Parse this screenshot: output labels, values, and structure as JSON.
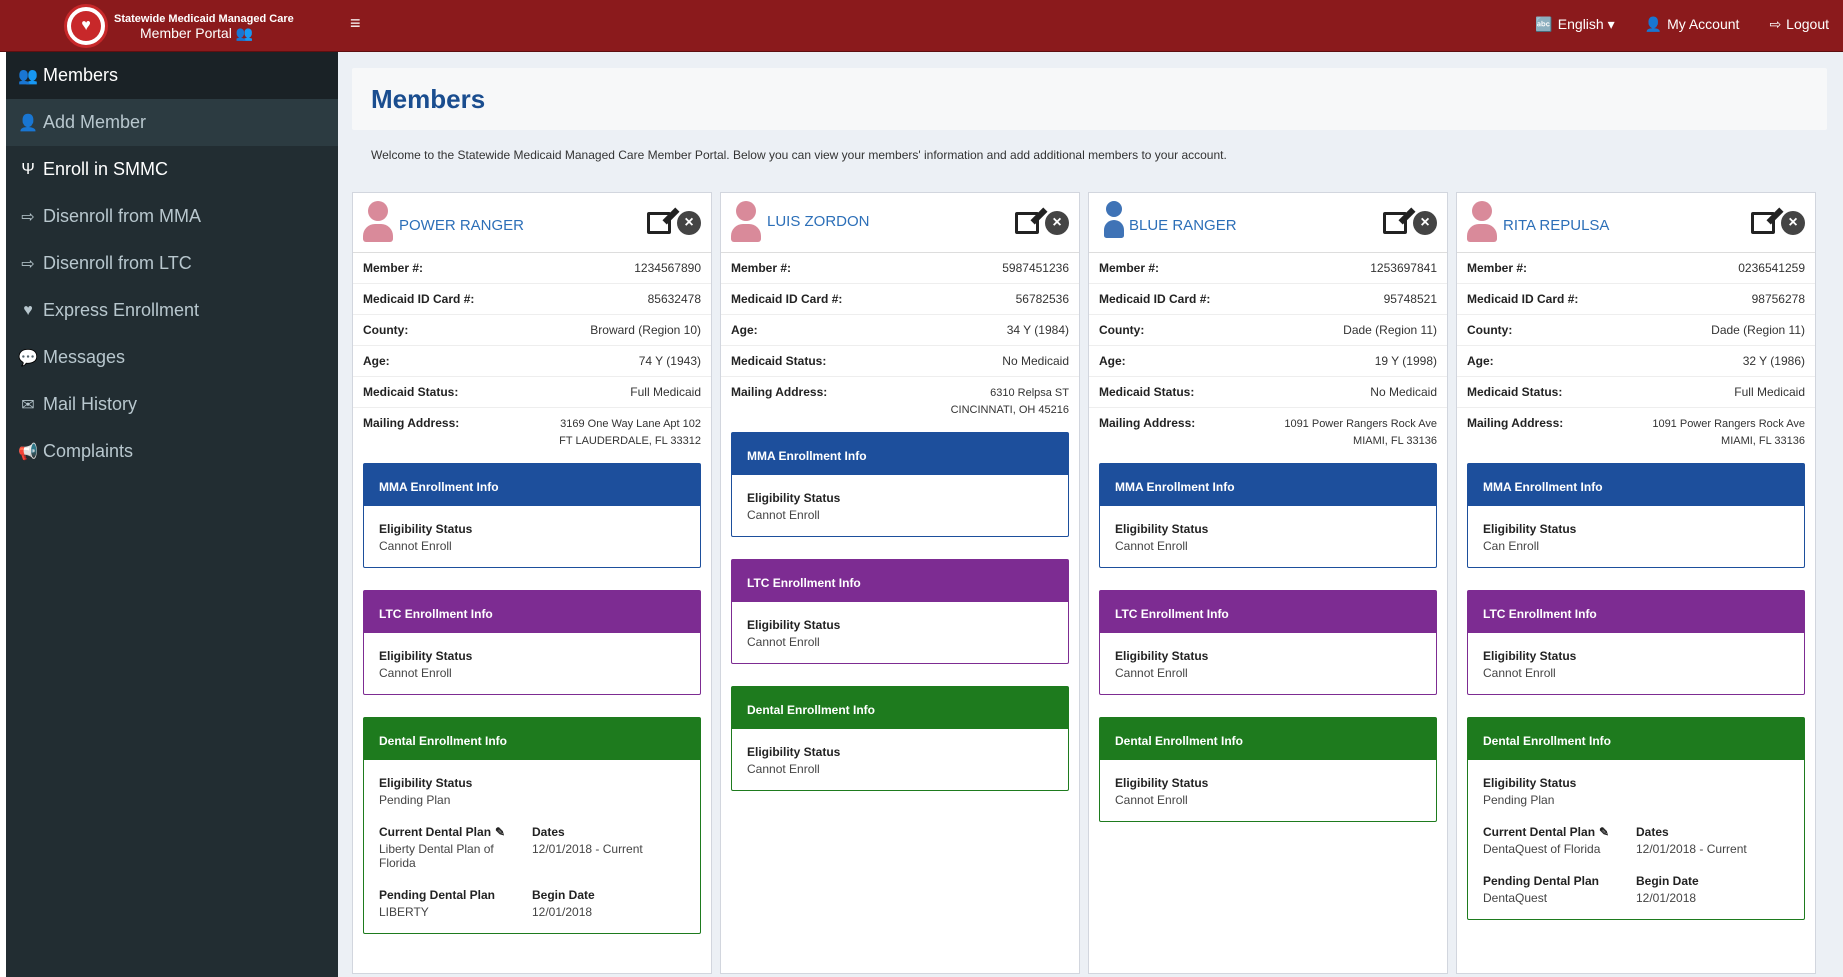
{
  "brand": {
    "line1": "Statewide Medicaid Managed Care",
    "line2": "Member Portal"
  },
  "topnav": {
    "language": "English",
    "account": "My Account",
    "logout": "Logout"
  },
  "sidebar": {
    "items": [
      {
        "label": "Members",
        "icon": "users-icon"
      },
      {
        "label": "Add Member",
        "icon": "user-icon"
      },
      {
        "label": "Enroll in SMMC",
        "icon": "stethoscope-icon"
      },
      {
        "label": "Disenroll from MMA",
        "icon": "sign-out-icon"
      },
      {
        "label": "Disenroll from LTC",
        "icon": "sign-out-icon"
      },
      {
        "label": "Express Enrollment",
        "icon": "heartbeat-icon"
      },
      {
        "label": "Messages",
        "icon": "comments-icon"
      },
      {
        "label": "Mail History",
        "icon": "envelope-icon"
      },
      {
        "label": "Complaints",
        "icon": "bullhorn-icon"
      }
    ]
  },
  "page": {
    "title": "Members",
    "welcome": "Welcome to the Statewide Medicaid Managed Care Member Portal. Below you can view your members' information and add additional members to your account."
  },
  "labels": {
    "member_no": "Member #:",
    "medicaid_id": "Medicaid ID Card #:",
    "county": "County:",
    "age": "Age:",
    "medicaid_status": "Medicaid Status:",
    "mailing_address": "Mailing Address:",
    "mma_header": "MMA Enrollment Info",
    "ltc_header": "LTC Enrollment Info",
    "dental_header": "Dental Enrollment Info",
    "eligibility": "Eligibility Status",
    "current_dental": "Current Dental Plan",
    "dates": "Dates",
    "pending_dental": "Pending Dental Plan",
    "begin_date": "Begin Date"
  },
  "members": [
    {
      "name": "POWER RANGER",
      "member_no": "1234567890",
      "medicaid_id": "85632478",
      "county": "Broward (Region 10)",
      "age": "74 Y (1943)",
      "medicaid_status": "Full Medicaid",
      "addr1": "3169 One Way Lane Apt 102",
      "addr2": "FT LAUDERDALE, FL 33312",
      "mma": "Cannot Enroll",
      "ltc": "Cannot Enroll",
      "dental": "Pending Plan",
      "current_dental": "Liberty Dental Plan of Florida",
      "dates": "12/01/2018 - Current",
      "pending_dental": "LIBERTY",
      "begin_date": "12/01/2018",
      "avatar_color": "#d98a9a"
    },
    {
      "name": "LUIS ZORDON",
      "member_no": "5987451236",
      "medicaid_id": "56782536",
      "age": "34 Y (1984)",
      "medicaid_status": "No Medicaid",
      "addr1": "6310 Relpsa ST",
      "addr2": "CINCINNATI, OH 45216",
      "mma": "Cannot Enroll",
      "ltc": "Cannot Enroll",
      "dental": "Cannot Enroll",
      "avatar_color": "#d98a9a"
    },
    {
      "name": "BLUE RANGER",
      "member_no": "1253697841",
      "medicaid_id": "95748521",
      "county": "Dade (Region 11)",
      "age": "19 Y (1998)",
      "medicaid_status": "No Medicaid",
      "addr1": "1091 Power Rangers Rock Ave",
      "addr2": "MIAMI, FL 33136",
      "mma": "Cannot Enroll",
      "ltc": "Cannot Enroll",
      "dental": "Cannot Enroll",
      "avatar_color": "#3f73b6"
    },
    {
      "name": "RITA REPULSA",
      "member_no": "0236541259",
      "medicaid_id": "98756278",
      "county": "Dade (Region 11)",
      "age": "32 Y (1986)",
      "medicaid_status": "Full Medicaid",
      "addr1": "1091 Power Rangers Rock Ave",
      "addr2": "MIAMI, FL 33136",
      "mma": "Can Enroll",
      "ltc": "Cannot Enroll",
      "dental": "Pending Plan",
      "current_dental": "DentaQuest of Florida",
      "dates": "12/01/2018 - Current",
      "pending_dental": "DentaQuest",
      "begin_date": "12/01/2018",
      "avatar_color": "#d98a9a"
    }
  ]
}
